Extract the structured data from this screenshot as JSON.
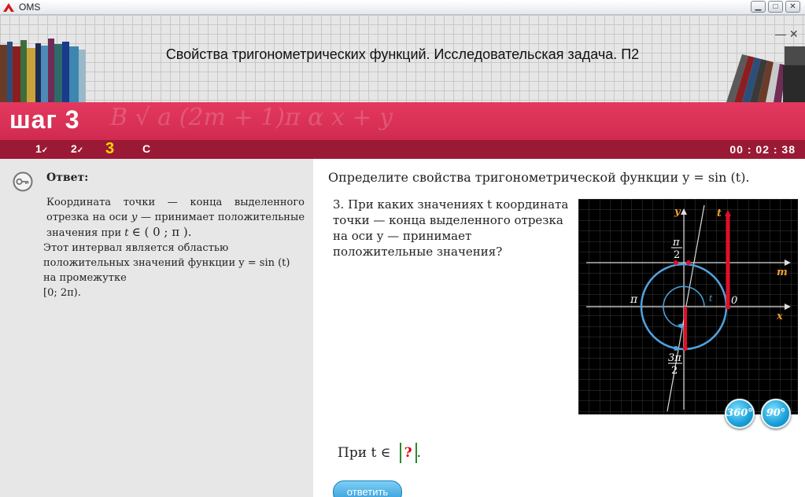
{
  "window": {
    "app_title": "OMS"
  },
  "header": {
    "lesson_title": "Свойства тригонометрических функций. Исследовательская задача. П2"
  },
  "step": {
    "title": "шаг 3",
    "nav": [
      {
        "label": "1",
        "check": "✓"
      },
      {
        "label": "2",
        "check": "✓"
      },
      {
        "label": "3",
        "check": ""
      },
      {
        "label": "С",
        "check": ""
      }
    ],
    "timer": "00 : 02 : 38"
  },
  "answer_panel": {
    "label": "Ответ:",
    "text1_a": "Координата точки — конца выделенного отрезка на оси",
    "text1_y": "y",
    "text1_b": "— принимает положительные значения при",
    "text1_t": "t",
    "text1_interval": "∈ ( 0 ; π ).",
    "text2_a": "Этот интервал является областью положительных значений функции",
    "text2_fn": "y = sin (t)",
    "text2_b": "на промежутке",
    "text2_range": "[0; 2π)."
  },
  "task": {
    "title": "Определите свойства тригонометрической функции y = sin (t).",
    "question": "3. При каких значениях t координата точки — конца выделенного отрезка на оси y — принимает положительные значения?",
    "answer_prefix": "При t ∈",
    "answer_placeholder": "?",
    "answer_suffix": "."
  },
  "graph": {
    "label_y": "y",
    "label_t": "t",
    "label_m": "m",
    "label_x": "x",
    "label_pi": "π",
    "label_zero": "0",
    "label_pi_half_num": "π",
    "label_pi_half_den": "2",
    "label_3pi_half_num": "3π",
    "label_3pi_half_den": "2",
    "label_angle": "t"
  },
  "buttons": {
    "btn_360": "360°",
    "btn_90": "90°",
    "submit": "ответить"
  }
}
